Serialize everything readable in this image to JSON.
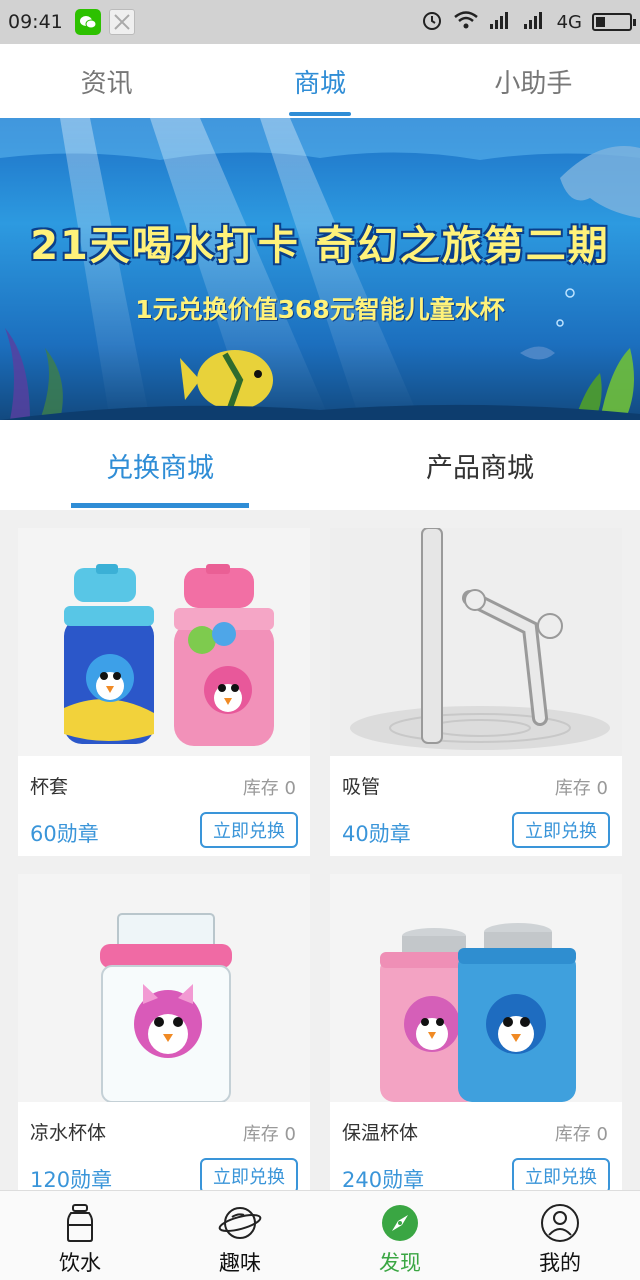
{
  "status_bar": {
    "time": "09:41",
    "network": "4G"
  },
  "top_tabs": [
    {
      "label": "资讯",
      "active": false
    },
    {
      "label": "商城",
      "active": true
    },
    {
      "label": "小助手",
      "active": false
    }
  ],
  "banner": {
    "title": "21天喝水打卡 奇幻之旅第二期",
    "subtitle": "1元兑换价值368元智能儿童水杯"
  },
  "sub_tabs": [
    {
      "label": "兑换商城",
      "active": true
    },
    {
      "label": "产品商城",
      "active": false
    }
  ],
  "products": [
    {
      "name": "杯套",
      "stock": "库存 0",
      "price": "60勋章",
      "button": "立即兑换"
    },
    {
      "name": "吸管",
      "stock": "库存 0",
      "price": "40勋章",
      "button": "立即兑换"
    },
    {
      "name": "凉水杯体",
      "stock": "库存 0",
      "price": "120勋章",
      "button": "立即兑换"
    },
    {
      "name": "保温杯体",
      "stock": "库存 0",
      "price": "240勋章",
      "button": "立即兑换"
    }
  ],
  "bottom_nav": [
    {
      "label": "饮水",
      "icon": "bottle-icon",
      "active": false
    },
    {
      "label": "趣味",
      "icon": "planet-icon",
      "active": false
    },
    {
      "label": "发现",
      "icon": "compass-icon",
      "active": true
    },
    {
      "label": "我的",
      "icon": "user-icon",
      "active": false
    }
  ],
  "colors": {
    "accent": "#2f8dd6",
    "nav_active": "#3aa643"
  }
}
